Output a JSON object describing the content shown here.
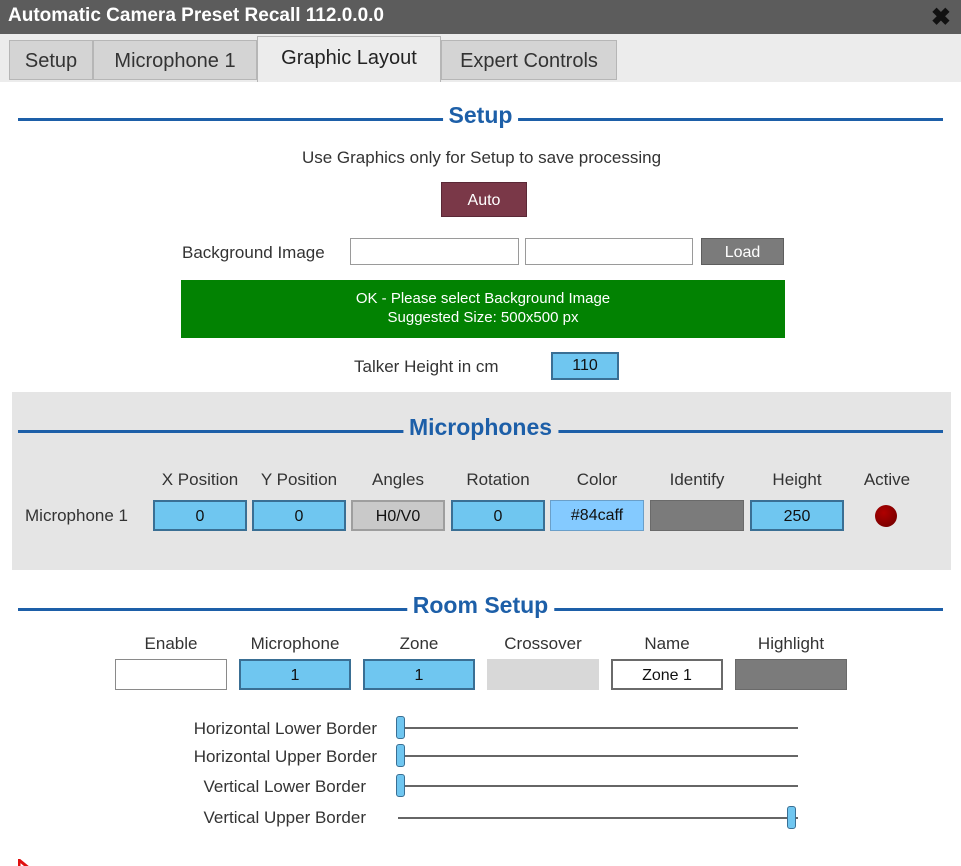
{
  "window": {
    "title": "Automatic Camera Preset Recall 112.0.0.0"
  },
  "tabs": [
    {
      "label": "Setup"
    },
    {
      "label": "Microphone 1"
    },
    {
      "label": "Graphic Layout"
    },
    {
      "label": "Expert Controls"
    }
  ],
  "setup": {
    "heading": "Setup",
    "hint": "Use Graphics only for Setup to save processing",
    "auto_label": "Auto",
    "background_label": "Background Image",
    "background_value_1": "",
    "background_value_2": "",
    "load_label": "Load",
    "status_line1": "OK - Please select Background Image",
    "status_line2": "Suggested Size: 500x500 px",
    "talker_label": "Talker Height in cm",
    "talker_value": "110"
  },
  "microphones": {
    "heading": "Microphones",
    "columns": [
      "X Position",
      "Y Position",
      "Angles",
      "Rotation",
      "Color",
      "Identify",
      "Height",
      "Active"
    ],
    "row": {
      "name": "Microphone 1",
      "x": "0",
      "y": "0",
      "angles": "H0/V0",
      "rotation": "0",
      "color": "#84caff",
      "identify": "",
      "height": "250"
    }
  },
  "room": {
    "heading": "Room Setup",
    "columns": [
      "Enable",
      "Microphone",
      "Zone",
      "Crossover",
      "Name",
      "Highlight"
    ],
    "row": {
      "enable": "",
      "microphone": "1",
      "zone": "1",
      "crossover": "",
      "name": "Zone 1",
      "highlight": ""
    },
    "sliders": [
      {
        "label": "Horizontal Lower Border",
        "value": 0
      },
      {
        "label": "Horizontal Upper Border",
        "value": 0
      },
      {
        "label": "Vertical Lower Border",
        "value": 0
      },
      {
        "label": "Vertical Upper Border",
        "value": 1
      }
    ]
  },
  "colors": {
    "title_bar": "#5c5c5c",
    "accent_blue": "#1d5fa8",
    "field_blue": "#6fc6f0",
    "auto_button": "#7a3848",
    "status_green": "#028202",
    "active_led": "#8b0000"
  }
}
